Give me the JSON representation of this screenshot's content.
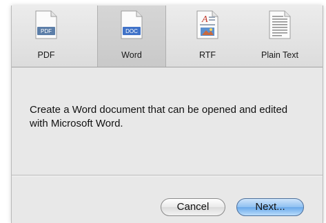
{
  "tabs": [
    {
      "label": "PDF",
      "icon": "pdf-document-icon",
      "icon_badge": "PDF",
      "selected": false
    },
    {
      "label": "Word",
      "icon": "doc-document-icon",
      "icon_badge": "DOC",
      "selected": true
    },
    {
      "label": "RTF",
      "icon": "rtf-document-icon",
      "icon_badge": "A",
      "selected": false
    },
    {
      "label": "Plain Text",
      "icon": "text-document-icon",
      "selected": false
    }
  ],
  "description": "Create a Word document that can be opened and edited with Microsoft Word.",
  "buttons": {
    "cancel_label": "Cancel",
    "next_label": "Next..."
  },
  "colors": {
    "selected_tab": "#cdcdcd",
    "default_button": "#6aa9ea",
    "pdf_badge": "#5c7ea8",
    "doc_badge": "#3f72c8"
  }
}
